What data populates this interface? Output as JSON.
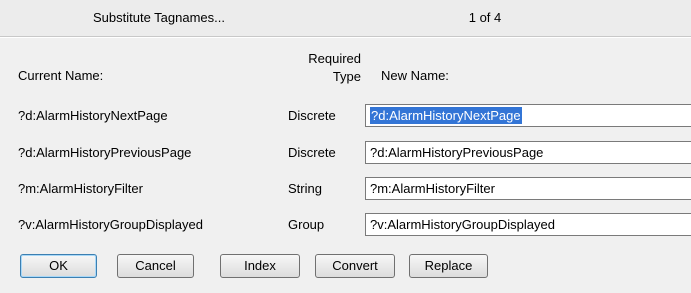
{
  "header": {
    "title": "Substitute Tagnames...",
    "page_counter": "1 of  4"
  },
  "columns": {
    "current_name": "Current Name:",
    "required_line1": "Required",
    "required_line2": "Type",
    "new_name": "New Name:"
  },
  "rows": [
    {
      "current": "?d:AlarmHistoryNextPage",
      "type": "Discrete",
      "new": "?d:AlarmHistoryNextPage"
    },
    {
      "current": "?d:AlarmHistoryPreviousPage",
      "type": "Discrete",
      "new": "?d:AlarmHistoryPreviousPage"
    },
    {
      "current": "?m:AlarmHistoryFilter",
      "type": "String",
      "new": "?m:AlarmHistoryFilter"
    },
    {
      "current": "?v:AlarmHistoryGroupDisplayed",
      "type": "Group",
      "new": "?v:AlarmHistoryGroupDisplayed"
    }
  ],
  "buttons": {
    "ok": "OK",
    "cancel": "Cancel",
    "index": "Index",
    "convert": "Convert",
    "replace": "Replace"
  },
  "colors": {
    "selection": "#3375d6",
    "background": "#f0f0f0"
  }
}
